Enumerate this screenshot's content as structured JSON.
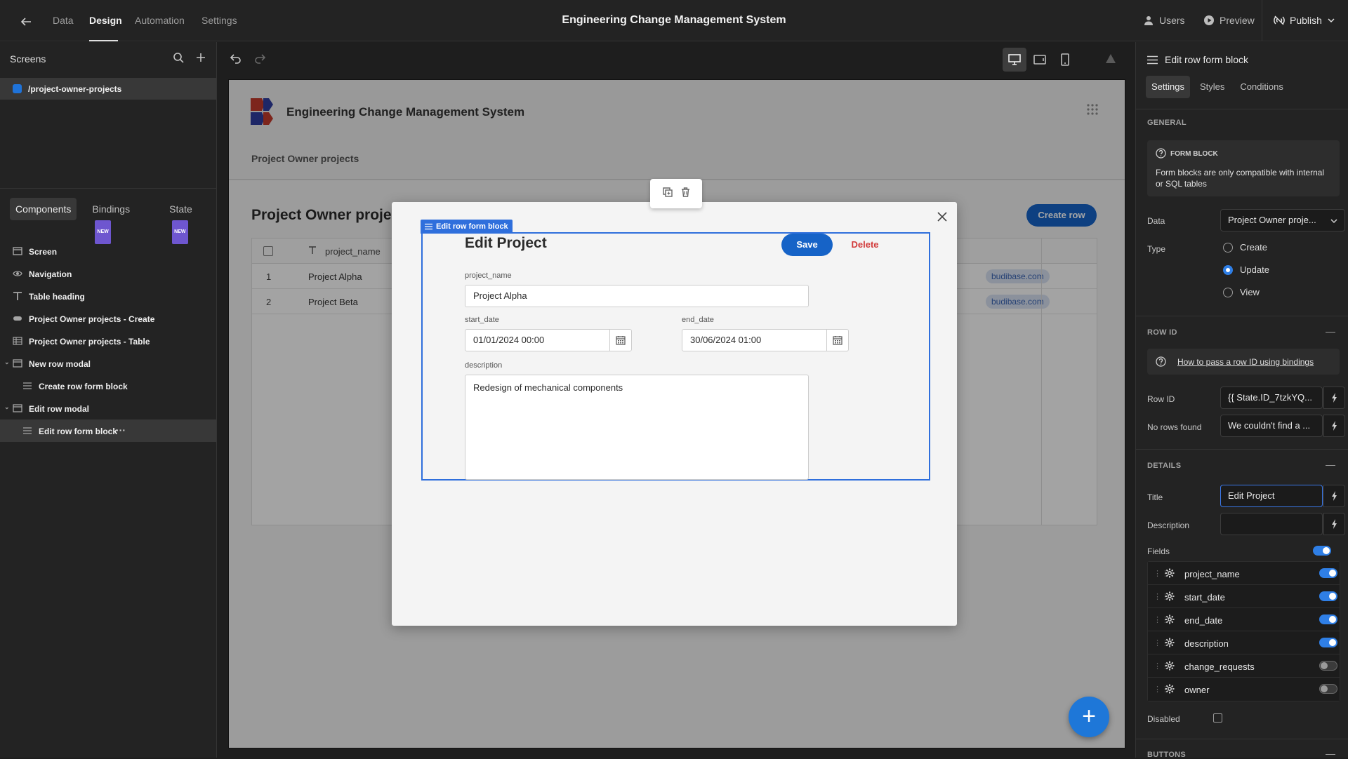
{
  "topbar": {
    "tabs": [
      "Data",
      "Design",
      "Automation",
      "Settings"
    ],
    "active_tab": "Design",
    "title": "Engineering Change Management System",
    "users_label": "Users",
    "preview_label": "Preview",
    "publish_label": "Publish"
  },
  "left_panel": {
    "screens_title": "Screens",
    "screen_route": "/project-owner-projects",
    "screen_color": "#1f73d9",
    "tabs": [
      {
        "label": "Components",
        "badge": ""
      },
      {
        "label": "Bindings",
        "badge": "NEW"
      },
      {
        "label": "State",
        "badge": "NEW"
      }
    ],
    "tree": [
      {
        "label": "Screen",
        "icon": "screen-icon"
      },
      {
        "label": "Navigation",
        "icon": "eye-icon"
      },
      {
        "label": "Table heading",
        "icon": "text-icon"
      },
      {
        "label": "Project Owner projects - Create",
        "icon": "button-icon"
      },
      {
        "label": "Project Owner projects - Table",
        "icon": "table-icon"
      },
      {
        "label": "New row modal",
        "icon": "modal-icon"
      },
      {
        "label": "Create row form block",
        "icon": "form-icon"
      },
      {
        "label": "Edit row modal",
        "icon": "modal-icon"
      },
      {
        "label": "Edit row form block",
        "icon": "form-icon"
      }
    ],
    "more_label": "···"
  },
  "canvas": {
    "app_title": "Engineering Change Management System",
    "nav_item": "Project Owner projects",
    "page_heading": "Project Owner projects",
    "create_row_label": "Create row",
    "table": {
      "column": "project_name",
      "rows": [
        {
          "num": "1",
          "name": "Project Alpha",
          "email": "budibase.com"
        },
        {
          "num": "2",
          "name": "Project Beta",
          "email": "budibase.com"
        }
      ]
    },
    "modal": {
      "block_tag": "Edit row form block",
      "title": "Edit Project",
      "save_label": "Save",
      "delete_label": "Delete",
      "fields": {
        "project_name_label": "project_name",
        "project_name_value": "Project Alpha",
        "start_date_label": "start_date",
        "start_date_value": "01/01/2024 00:00",
        "end_date_label": "end_date",
        "end_date_value": "30/06/2024 01:00",
        "description_label": "description",
        "description_value": "Redesign of mechanical components"
      }
    },
    "fab_label": "+"
  },
  "right_panel": {
    "header": "Edit row form block",
    "tabs": [
      "Settings",
      "Styles",
      "Conditions"
    ],
    "active_tab": "Settings",
    "general_title": "GENERAL",
    "info_title": "FORM BLOCK",
    "info_text": "Form blocks are only compatible with internal or SQL tables",
    "data_label": "Data",
    "data_value": "Project Owner proje...",
    "type_label": "Type",
    "type_options": [
      "Create",
      "Update",
      "View"
    ],
    "type_selected": "Update",
    "row_id_title": "ROW ID",
    "row_id_help": "How to pass a row ID using bindings",
    "row_id_label": "Row ID",
    "row_id_value": "{{ State.ID_7tzkYQ...",
    "no_rows_label": "No rows found",
    "no_rows_value": "We couldn't find a ...",
    "details_title": "DETAILS",
    "title_label": "Title",
    "title_value": "Edit Project",
    "description_label": "Description",
    "description_value": "",
    "fields_label": "Fields",
    "fields_enabled": true,
    "field_list": [
      {
        "name": "project_name",
        "on": true
      },
      {
        "name": "start_date",
        "on": true
      },
      {
        "name": "end_date",
        "on": true
      },
      {
        "name": "description",
        "on": true
      },
      {
        "name": "change_requests",
        "on": false
      },
      {
        "name": "owner",
        "on": false
      }
    ],
    "disabled_label": "Disabled",
    "disabled_checked": false,
    "buttons_title": "BUTTONS",
    "collapse_symbol": "—"
  },
  "colors": {
    "accent": "#1663c7",
    "selection": "#2f6fdc",
    "delete": "#d23b3b",
    "new_badge": "#6e56cf"
  }
}
